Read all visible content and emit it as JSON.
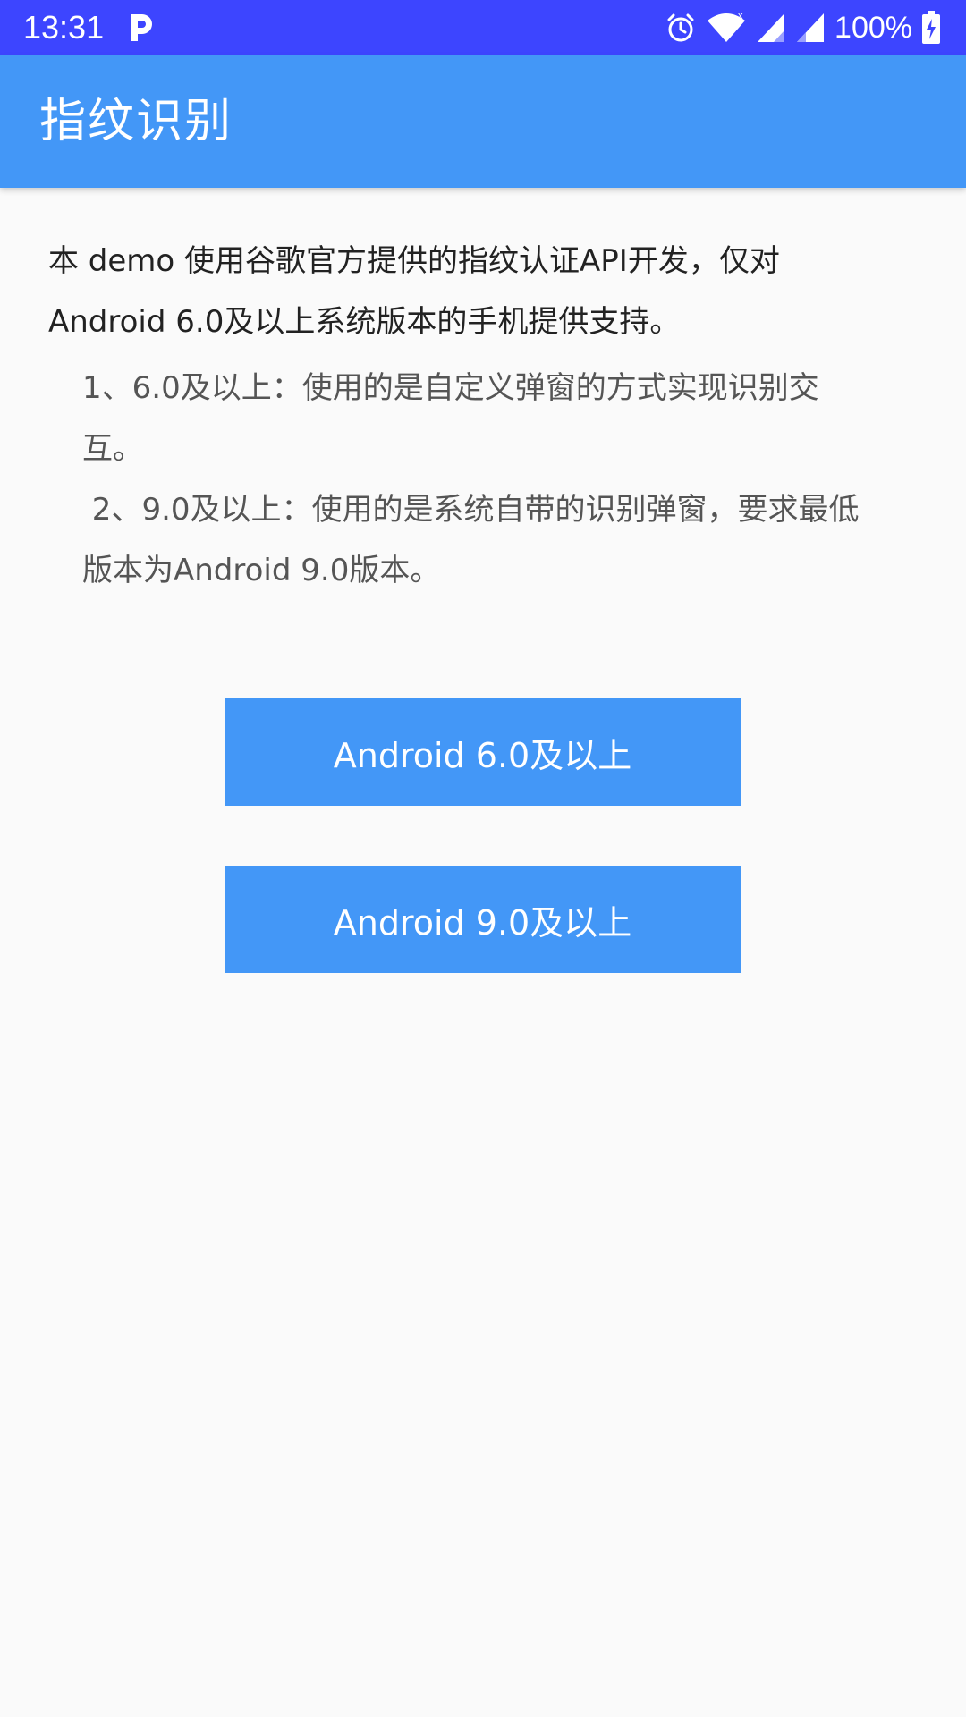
{
  "status_bar": {
    "time": "13:31",
    "battery": "100%",
    "icons": [
      "p-icon",
      "alarm-icon",
      "wifi-icon",
      "signal-icon",
      "signal-icon-2",
      "battery-charging-icon"
    ],
    "color": "#3d45ff"
  },
  "app_bar": {
    "title": "指纹识别",
    "color": "#4397f7"
  },
  "content": {
    "intro_line1": "本 demo 使用谷歌官方提供的指纹认证API开发，仅对",
    "intro_line2": "Android 6.0及以上系统版本的手机提供支持。",
    "note1_line1": "1、6.0及以上：使用的是自定义弹窗的方式实现识别交",
    "note1_line2": "互。",
    "note2_line1": " 2、9.0及以上：使用的是系统自带的识别弹窗，要求最低",
    "note2_line2": "版本为Android 9.0版本。"
  },
  "buttons": {
    "android6_label": "Android 6.0及以上",
    "android9_label": "Android 9.0及以上"
  }
}
